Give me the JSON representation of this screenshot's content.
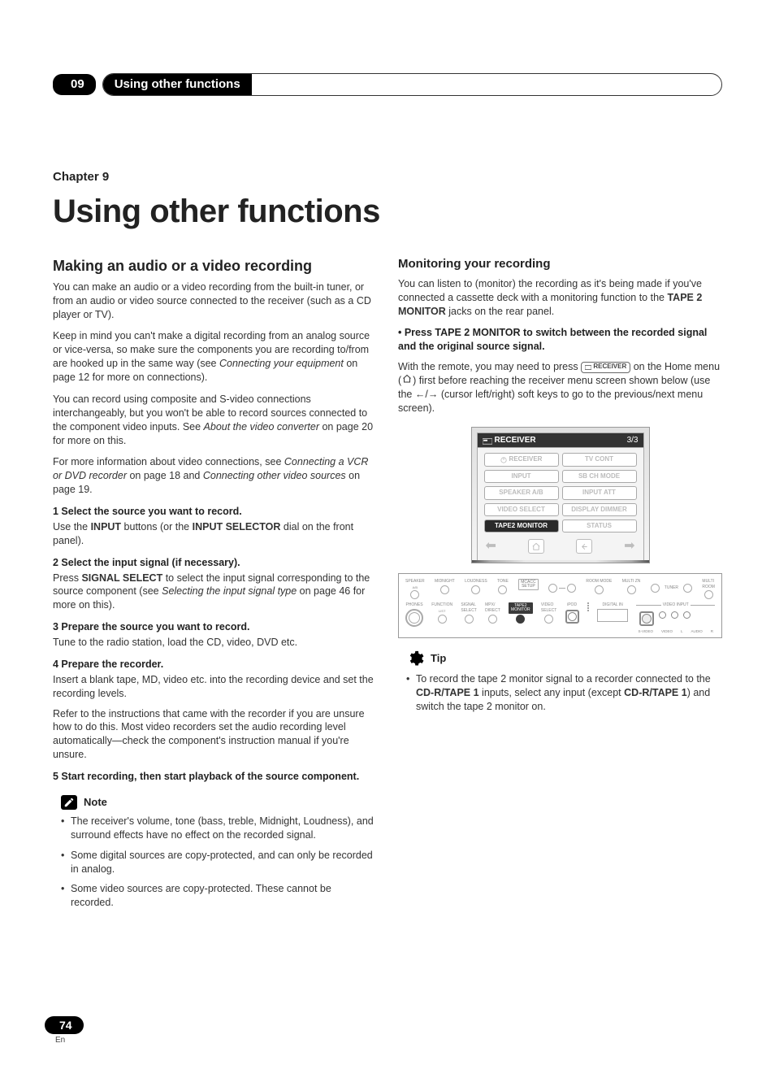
{
  "header": {
    "chapter_no": "09",
    "bar_title": "Using other functions"
  },
  "title": {
    "chapter_label": "Chapter 9",
    "chapter_title": "Using other functions"
  },
  "left": {
    "h2": "Making an audio or a video recording",
    "p1": "You can make an audio or a video recording from the built-in tuner, or from an audio or video source connected to the receiver (such as a CD player or TV).",
    "p2a": "Keep in mind you can't make a digital recording from an analog source or vice-versa, so make sure the components you are recording to/from are hooked up in the same way (see ",
    "p2i": "Connecting your equipment",
    "p2b": " on page 12 for more on connections).",
    "p3a": "You can record using composite and S-video connections interchangeably, but you won't be able to record sources connected to the component video inputs. See ",
    "p3i": "About the video converter",
    "p3b": " on page 20 for more on this.",
    "p4a": "For more information about video connections, see ",
    "p4i1": "Connecting a VCR or DVD recorder",
    "p4m": " on page 18 and ",
    "p4i2": "Connecting other video sources",
    "p4b": " on page 19.",
    "s1h": "1    Select the source you want to record.",
    "s1ba": "Use the ",
    "s1bb": "INPUT",
    "s1bc": " buttons (or the ",
    "s1bd": "INPUT SELECTOR",
    "s1be": " dial on the front panel).",
    "s2h": "2    Select the input signal (if necessary).",
    "s2ba": "Press ",
    "s2bb": "SIGNAL SELECT",
    "s2bc": " to select the input signal corresponding to the source component (see ",
    "s2bi": "Selecting the input signal type",
    "s2bd": " on page 46 for more on this).",
    "s3h": "3    Prepare the source you want to record.",
    "s3b": "Tune to the radio station, load the CD, video, DVD etc.",
    "s4h": "4    Prepare the recorder.",
    "s4b1": "Insert a blank tape, MD, video etc. into the recording device and set the recording levels.",
    "s4b2": "Refer to the instructions that came with the recorder if you are unsure how to do this. Most video recorders set the audio recording level automatically—check the component's instruction manual if you're unsure.",
    "s5h": "5    Start recording, then start playback of the source component.",
    "note_label": "Note",
    "note1": "The receiver's volume, tone (bass, treble, Midnight, Loudness), and surround effects have no effect on the recorded signal.",
    "note2": "Some digital sources are copy-protected, and can only be recorded in analog.",
    "note3": "Some video sources are copy-protected. These cannot be recorded."
  },
  "right": {
    "h3": "Monitoring your recording",
    "p1a": "You can listen to (monitor) the recording as it's being made if you've connected a cassette deck with a monitoring function to the ",
    "p1b": "TAPE 2 MONITOR",
    "p1c": " jacks on the rear panel.",
    "bullet": "•    Press TAPE 2 MONITOR to switch between the recorded signal and the original source signal.",
    "p2a": "With the remote, you may need to press ",
    "p2btn": "RECEIVER",
    "p2b": " on the Home menu (",
    "p2c": ") first before reaching the receiver menu screen shown below (use the ",
    "p2d": " (cursor left/right) soft keys to go to the previous/next menu screen).",
    "remote": {
      "title": "RECEIVER",
      "page": "3/3",
      "b_receiver": "RECEIVER",
      "b_tv": "TV CONT",
      "b_input": "INPUT",
      "b_sbch": "SB CH MODE",
      "b_spk": "SPEAKER A/B",
      "b_att": "INPUT ATT",
      "b_vid": "VIDEO SELECT",
      "b_dim": "DISPLAY DIMMER",
      "b_tape2": "TAPE2 MONITOR",
      "b_status": "STATUS"
    },
    "tip_label": "Tip",
    "tip1a": "To record the tape 2 monitor signal to a recorder connected to the ",
    "tip1b": "CD-R/TAPE 1",
    "tip1c": " inputs, select any input (except ",
    "tip1d": "CD-R/TAPE 1",
    "tip1e": ") and switch the tape 2 monitor on."
  },
  "pagenum": "74",
  "pagenum_lang": "En"
}
